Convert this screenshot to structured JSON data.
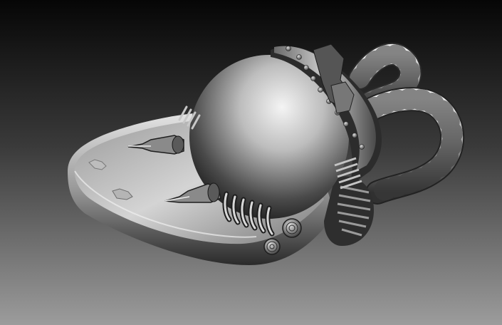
{
  "viewport": {
    "background_top": "#060606",
    "background_bottom": "#9c9c9c"
  },
  "model": {
    "subject": "sculpted-sci-fi-pod-render",
    "material_light": "#e8e8e8",
    "material_mid": "#8a8a8a",
    "material_dark": "#1c1c1c"
  }
}
